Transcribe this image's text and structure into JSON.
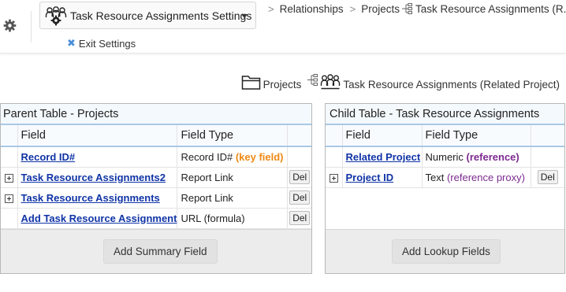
{
  "header": {
    "settings_label": "Task Resource Assignments Settings",
    "exit_label": "Exit Settings"
  },
  "breadcrumb": {
    "items": [
      "Relationships",
      "Projects",
      "Task Resource Assignments (R..."
    ]
  },
  "relationship_path": {
    "parent": "Projects",
    "child": "Task Resource Assignments (Related Project)"
  },
  "parent_table": {
    "title": "Parent Table - Projects",
    "col_field": "Field",
    "col_type": "Field Type",
    "rows": [
      {
        "field": "Record ID#",
        "type": "Record ID#",
        "note": "(key field)"
      },
      {
        "field": "Task Resource Assignments2",
        "type": "Report Link",
        "del": "Del"
      },
      {
        "field": "Task Resource Assignments",
        "type": "Report Link",
        "del": "Del"
      },
      {
        "field": "Add Task Resource Assignment",
        "type": "URL (formula)",
        "del": "Del"
      }
    ],
    "button": "Add Summary Field"
  },
  "child_table": {
    "title": "Child Table - Task Resource Assignments",
    "col_field": "Field",
    "col_type": "Field Type",
    "rows": [
      {
        "field": "Related Project",
        "type": "Numeric",
        "note": "(reference)"
      },
      {
        "field": "Project ID",
        "type": "Text",
        "note": "(reference proxy)",
        "del": "Del"
      }
    ],
    "button": "Add Lookup Fields"
  },
  "colors": {
    "link": "#1034a6",
    "key_field": "#f08a14",
    "reference": "#7b2a8f",
    "table_accent": "#a9c8e5",
    "exit_x": "#4a8fd8"
  }
}
